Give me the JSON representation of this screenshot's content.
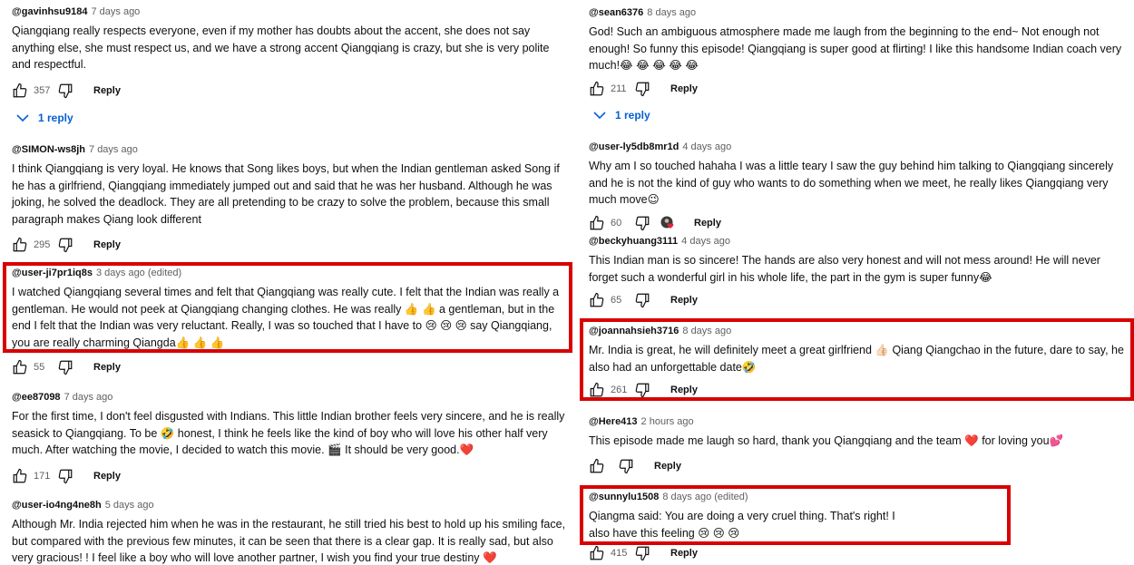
{
  "left": [
    {
      "author": "@gavinhsu9184",
      "time": "7 days ago",
      "body": "Qiangqiang really respects everyone, even if my mother has doubts about the accent, she does not say anything else, she must respect us, and we have a strong accent Qiangqiang is crazy, but she is very polite and respectful.",
      "likes": "357",
      "reply_label": "Reply",
      "replies_label": "1 reply"
    },
    {
      "author": "@SIMON-ws8jh",
      "time": "7 days ago",
      "body": "I think Qiangqiang is very loyal. He knows that Song likes boys, but when the Indian gentleman asked Song if he has a girlfriend, Qiangqiang immediately jumped out and said that he was her husband. Although he was joking, he solved the deadlock. They are all pretending to be crazy to solve the problem, because this small paragraph makes Qiang look different",
      "likes": "295",
      "reply_label": "Reply"
    },
    {
      "author": "@user-ji7pr1iq8s",
      "time": "3 days ago (edited)",
      "body": "I watched Qiangqiang several times and felt that Qiangqiang was really cute. I felt that the Indian was really a gentleman. He would not peek at Qiangqiang changing clothes. He was really 👍 👍 a gentleman, but in the end I felt that the Indian was very reluctant. Really, I was so touched that I have to 😢 😢 😢 say Qiangqiang, you are really charming Qiangda👍 👍 👍",
      "likes": "55",
      "reply_label": "Reply"
    },
    {
      "author": "@ee87098",
      "time": "7 days ago",
      "body": "For the first time, I don't feel disgusted with Indians. This little Indian brother feels very sincere, and he is really seasick to Qiangqiang. To be 🤣 honest, I think he feels like the kind of boy who will love his other half very much. After watching the movie, I decided to watch this movie. 🎬 It should be very good.❤️",
      "likes": "171",
      "reply_label": "Reply"
    },
    {
      "author": "@user-io4ng4ne8h",
      "time": "5 days ago",
      "body": "Although Mr. India rejected him when he was in the restaurant, he still tried his best to hold up his smiling face, but compared with the previous few minutes, it can be seen that there is a clear gap. It is really sad, but also very gracious! ! I feel like a boy who will love another partner, I wish you find your true destiny ❤️"
    }
  ],
  "right": [
    {
      "author": "@sean6376",
      "time": "8 days ago",
      "body": "God! Such an ambiguous atmosphere made me laugh from the beginning to the end~ Not enough not enough! So funny this episode! Qiangqiang is super good at flirting! I like this handsome Indian coach very much!😂 😂 😂 😂 😂",
      "likes": "211",
      "reply_label": "Reply",
      "replies_label": "1 reply"
    },
    {
      "author": "@user-ly5db8mr1d",
      "time": "4 days ago",
      "body": "Why am I so touched hahaha I was a little teary I saw the guy behind him talking to Qiangqiang sincerely and he is not the kind of guy who wants to do something when we meet, he really likes Qiangqiang very much move😉",
      "likes": "60",
      "reply_label": "Reply"
    },
    {
      "author": "@beckyhuang3111",
      "time": "4 days ago",
      "body": "This Indian man is so sincere! The hands are also very honest and will not mess around! He will never forget such a wonderful girl in his whole life, the part in the gym is super funny😂",
      "likes": "65",
      "reply_label": "Reply"
    },
    {
      "author": "@joannahsieh3716",
      "time": "8 days ago",
      "body": "Mr. India is great, he will definitely meet a great girlfriend 👍🏻 Qiang Qiangchao in the future, dare to say, he also had an unforgettable date🤣",
      "likes": "261",
      "reply_label": "Reply"
    },
    {
      "author": "@Here413",
      "time": "2 hours ago",
      "body": "This episode made me laugh so hard, thank you Qiangqiang and the team ❤️ for loving you💕",
      "likes": "",
      "reply_label": "Reply"
    },
    {
      "author": "@sunnylu1508",
      "time": "8 days ago (edited)",
      "body": "Qiangma said: You are doing a very cruel thing. That's right! I also have this feeling 😢 😢 😢",
      "likes": "415",
      "reply_label": "Reply"
    }
  ],
  "colors": {
    "highlight": "#d80000",
    "link": "#065fd4",
    "heart": "#e3243b"
  }
}
